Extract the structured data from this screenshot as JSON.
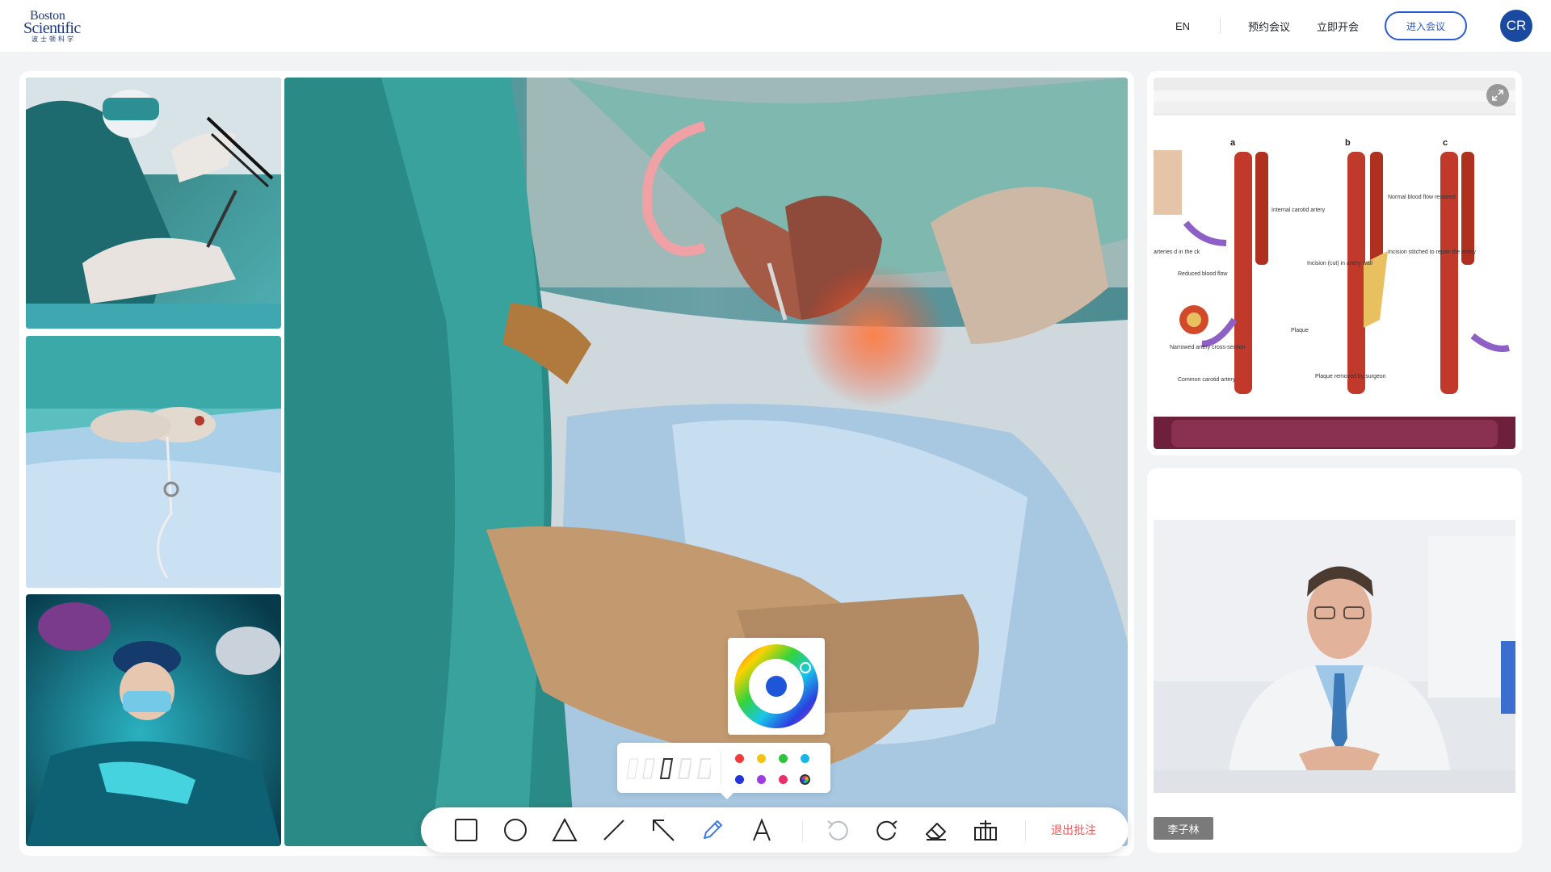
{
  "header": {
    "logo_line1": "Boston",
    "logo_line2": "Scientific",
    "logo_line3": "波士顿科学",
    "lang": "EN",
    "book_meeting": "预约会议",
    "start_meeting": "立即开会",
    "enter_meeting": "进入会议",
    "avatar_initials": "CR"
  },
  "video": {
    "participant_name": "李子林"
  },
  "toolbar": {
    "tools": [
      "rectangle",
      "circle",
      "triangle",
      "line",
      "arrow",
      "pen",
      "text",
      "undo",
      "redo",
      "eraser",
      "clear"
    ],
    "active_tool": "pen",
    "exit_label": "退出批注"
  },
  "color_picker": {
    "selected": "#1f55d8",
    "swatches": [
      "#f23b3b",
      "#f5c313",
      "#2dc43d",
      "#17b8e6",
      "#2233dd",
      "#a03be0",
      "#ec2e6a",
      "custom"
    ]
  },
  "shared_screen": {
    "diagram_labels": {
      "panel_a": "a",
      "panel_b": "b",
      "panel_c": "c",
      "internal_carotid": "Internal carotid artery",
      "reduced_flow": "Reduced blood flow",
      "narrowed": "Narrowed artery cross-section",
      "common_carotid": "Common carotid artery",
      "incision": "Incision (cut) in artery wall",
      "plaque": "Plaque",
      "plaque_removed": "Plaque removed by surgeon",
      "normal_flow": "Normal blood flow restored",
      "stitched": "Incision stitched to repair the artery",
      "arteries_neck": "arteries d in the ck"
    }
  }
}
